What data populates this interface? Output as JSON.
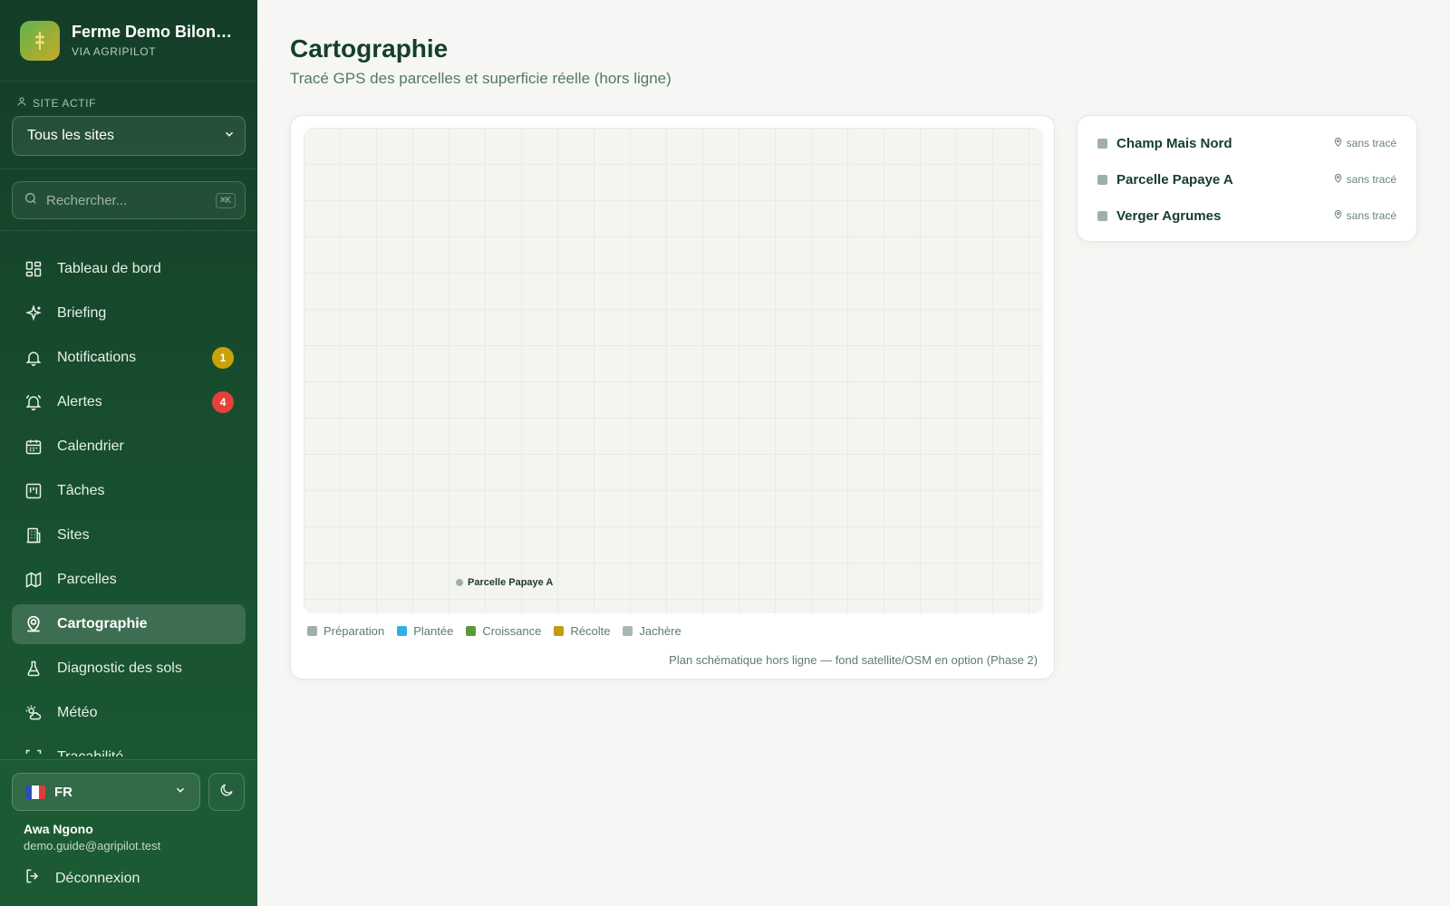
{
  "brand": {
    "title": "Ferme Demo Bilong...",
    "subtitle": "VIA AGRIPILOT"
  },
  "site_selector": {
    "label": "SITE ACTIF",
    "value": "Tous les sites"
  },
  "search": {
    "placeholder": "Rechercher...",
    "shortcut": "⌘K"
  },
  "nav": [
    {
      "label": "Tableau de bord",
      "icon": "dashboard-icon"
    },
    {
      "label": "Briefing",
      "icon": "sparkle-icon"
    },
    {
      "label": "Notifications",
      "icon": "bell-icon",
      "badge": "1",
      "badge_color": "#c9a20a"
    },
    {
      "label": "Alertes",
      "icon": "bell-ring-icon",
      "badge": "4",
      "badge_color": "#e5413b"
    },
    {
      "label": "Calendrier",
      "icon": "calendar-icon"
    },
    {
      "label": "Tâches",
      "icon": "kanban-icon"
    },
    {
      "label": "Sites",
      "icon": "building-icon"
    },
    {
      "label": "Parcelles",
      "icon": "map-icon"
    },
    {
      "label": "Cartographie",
      "icon": "map-pin-user-icon",
      "active": true
    },
    {
      "label": "Diagnostic des sols",
      "icon": "flask-icon"
    },
    {
      "label": "Météo",
      "icon": "sun-cloud-icon"
    },
    {
      "label": "Traçabilité",
      "icon": "scan-icon"
    }
  ],
  "footer": {
    "language": "FR",
    "user_name": "Awa Ngono",
    "user_email": "demo.guide@agripilot.test",
    "logout": "Déconnexion"
  },
  "page": {
    "title": "Cartographie",
    "subtitle": "Tracé GPS des parcelles et superficie réelle (hors ligne)"
  },
  "map": {
    "marker_label": "Parcelle Papaye A",
    "legend": [
      {
        "label": "Préparation",
        "color": "#9fb1a6"
      },
      {
        "label": "Plantée",
        "color": "#2fb0e8"
      },
      {
        "label": "Croissance",
        "color": "#5a9a3a"
      },
      {
        "label": "Récolte",
        "color": "#c49a12"
      },
      {
        "label": "Jachère",
        "color": "#a9b9ae"
      }
    ],
    "note": "Plan schématique hors ligne — fond satellite/OSM en option (Phase 2)"
  },
  "plots": [
    {
      "name": "Champ Mais Nord",
      "status": "sans tracé"
    },
    {
      "name": "Parcelle Papaye A",
      "status": "sans tracé"
    },
    {
      "name": "Verger Agrumes",
      "status": "sans tracé"
    }
  ]
}
